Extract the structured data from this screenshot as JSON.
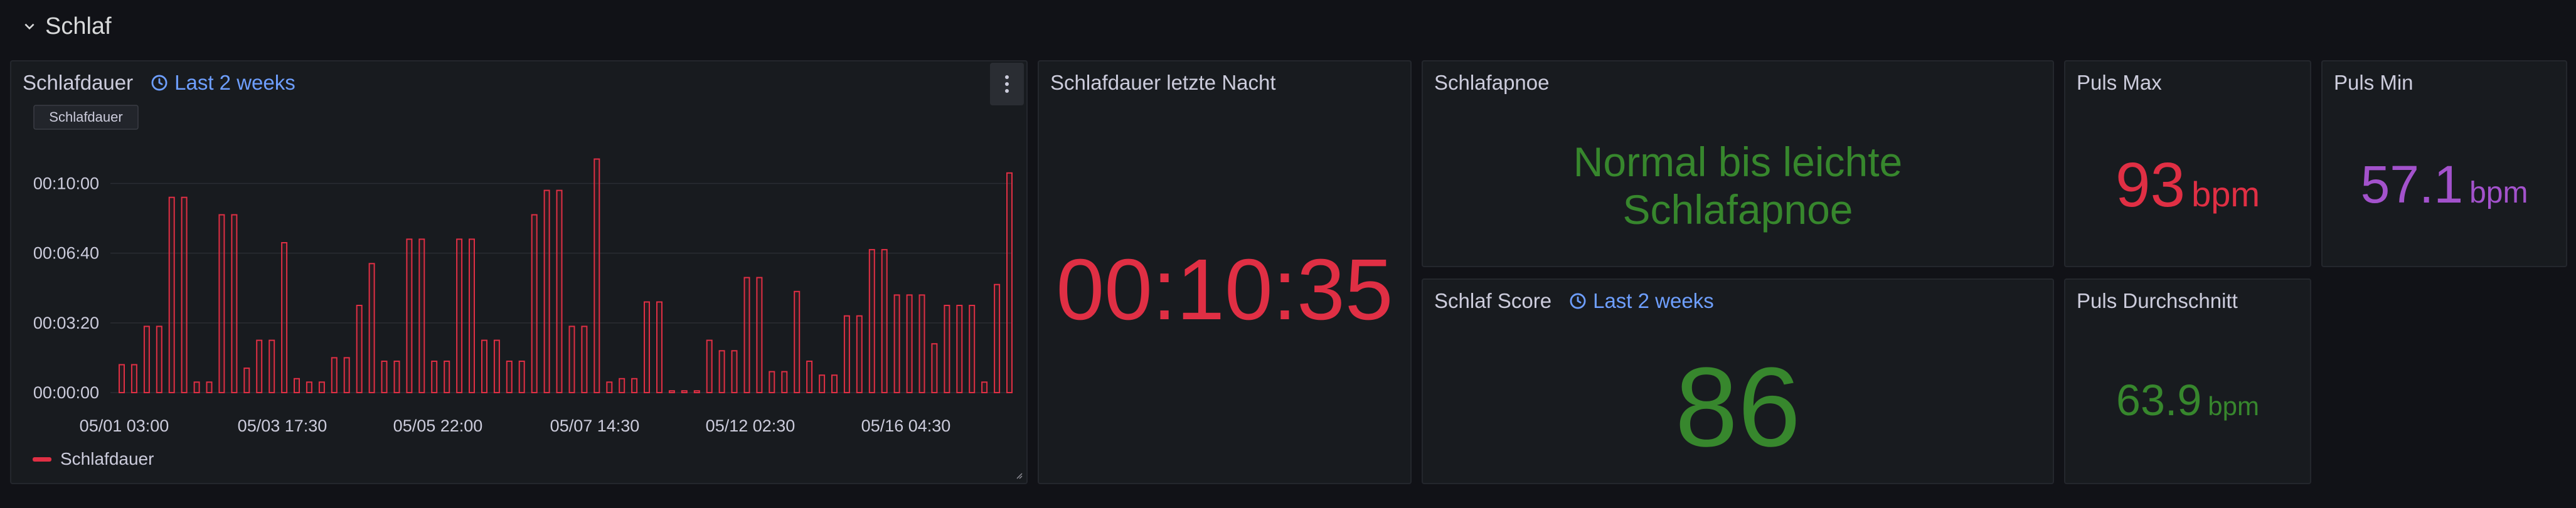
{
  "row": {
    "title": "Schlaf"
  },
  "panels": {
    "schlafdauer": {
      "title": "Schlafdauer",
      "time_info": "Last 2 weeks",
      "tooltip_tag": "Schlafdauer",
      "legend": "Schlafdauer"
    },
    "letzte_nacht": {
      "title": "Schlafdauer letzte Nacht",
      "value": "00:10:35",
      "color": "#e02f44"
    },
    "apnoe": {
      "title": "Schlafapnoe",
      "line1": "Normal bis leichte",
      "line2": "Schlafapnoe",
      "color": "#37872d"
    },
    "puls_max": {
      "title": "Puls Max",
      "value": "93",
      "unit": "bpm",
      "color": "#e02f44"
    },
    "puls_min": {
      "title": "Puls Min",
      "value": "57.1",
      "unit": "bpm",
      "color": "#a352cc"
    },
    "score": {
      "title": "Schlaf Score",
      "time_info": "Last 2 weeks",
      "value": "86",
      "color": "#37872d"
    },
    "puls_avg": {
      "title": "Puls Durchschnitt",
      "value": "63.9",
      "unit": "bpm",
      "color": "#37872d"
    }
  },
  "colors": {
    "bar": "#e02f44",
    "accent_link": "#6e9fff",
    "background": "#111217",
    "panel": "#181b1f"
  },
  "chart_data": {
    "type": "bar",
    "title": "Schlafdauer",
    "xlabel": "",
    "ylabel": "",
    "y_unit": "seconds",
    "y_tick_labels": [
      "00:00:00",
      "00:03:20",
      "00:06:40",
      "00:10:00"
    ],
    "y_ticks": [
      0,
      200,
      400,
      600
    ],
    "ylim": [
      0,
      680
    ],
    "x_tick_labels": [
      "05/01 03:00",
      "05/03 17:30",
      "05/05 22:00",
      "05/07 14:30",
      "05/12 02:30",
      "05/16 04:30"
    ],
    "grid": true,
    "legend_position": "bottom-left",
    "series": [
      {
        "name": "Schlafdauer",
        "values": [
          80,
          80,
          190,
          190,
          560,
          560,
          30,
          30,
          510,
          510,
          70,
          150,
          150,
          430,
          40,
          30,
          30,
          100,
          100,
          250,
          370,
          90,
          90,
          440,
          440,
          90,
          90,
          440,
          440,
          150,
          150,
          90,
          90,
          510,
          580,
          580,
          190,
          190,
          670,
          30,
          40,
          40,
          260,
          260,
          5,
          5,
          5,
          150,
          120,
          120,
          330,
          330,
          60,
          60,
          290,
          90,
          50,
          50,
          220,
          220,
          410,
          410,
          280,
          280,
          280,
          140,
          250,
          250,
          250,
          30,
          310,
          630
        ]
      }
    ]
  }
}
